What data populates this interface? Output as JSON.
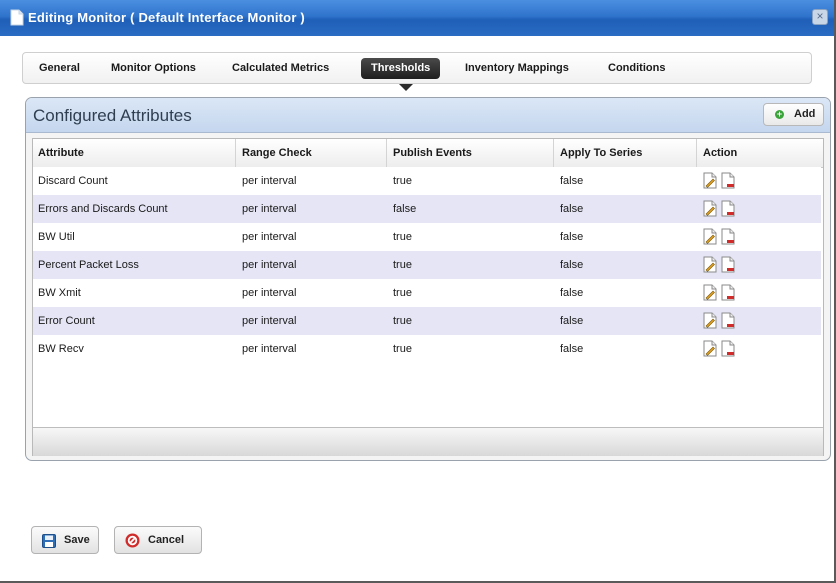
{
  "window": {
    "title": "Editing Monitor ( Default Interface Monitor )",
    "close_glyph": "×"
  },
  "tabs": [
    {
      "label": "General",
      "active": false
    },
    {
      "label": "Monitor Options",
      "active": false
    },
    {
      "label": "Calculated Metrics",
      "active": false
    },
    {
      "label": "Thresholds",
      "active": true
    },
    {
      "label": "Inventory Mappings",
      "active": false
    },
    {
      "label": "Conditions",
      "active": false
    }
  ],
  "panel": {
    "title": "Configured Attributes",
    "add_label": "Add",
    "add_glyph": "+"
  },
  "table": {
    "columns": [
      "Attribute",
      "Range Check",
      "Publish Events",
      "Apply To Series",
      "Action"
    ],
    "rows": [
      {
        "attribute": "Discard Count",
        "range_check": "per interval",
        "publish_events": "true",
        "apply_to_series": "false"
      },
      {
        "attribute": "Errors and Discards Count",
        "range_check": "per interval",
        "publish_events": "false",
        "apply_to_series": "false"
      },
      {
        "attribute": "BW Util",
        "range_check": "per interval",
        "publish_events": "true",
        "apply_to_series": "false"
      },
      {
        "attribute": "Percent Packet Loss",
        "range_check": "per interval",
        "publish_events": "true",
        "apply_to_series": "false"
      },
      {
        "attribute": "BW Xmit",
        "range_check": "per interval",
        "publish_events": "true",
        "apply_to_series": "false"
      },
      {
        "attribute": "Error Count",
        "range_check": "per interval",
        "publish_events": "true",
        "apply_to_series": "false"
      },
      {
        "attribute": "BW Recv",
        "range_check": "per interval",
        "publish_events": "true",
        "apply_to_series": "false"
      }
    ]
  },
  "footer": {
    "save_label": "Save",
    "cancel_label": "Cancel"
  },
  "icons": {
    "title": "document-icon",
    "close": "close-icon",
    "add": "add-icon",
    "edit": "edit-icon",
    "delete": "delete-icon",
    "save": "save-icon",
    "cancel": "cancel-icon"
  },
  "colors": {
    "titlebar": "#2f74cc",
    "active_tab": "#2a2a2a",
    "panel_header": "#c4d6ee",
    "alt_row": "#e5e5f6",
    "add_green": "#3aa33a",
    "cancel_red": "#d12c2c",
    "save_blue": "#2f6fb7"
  }
}
